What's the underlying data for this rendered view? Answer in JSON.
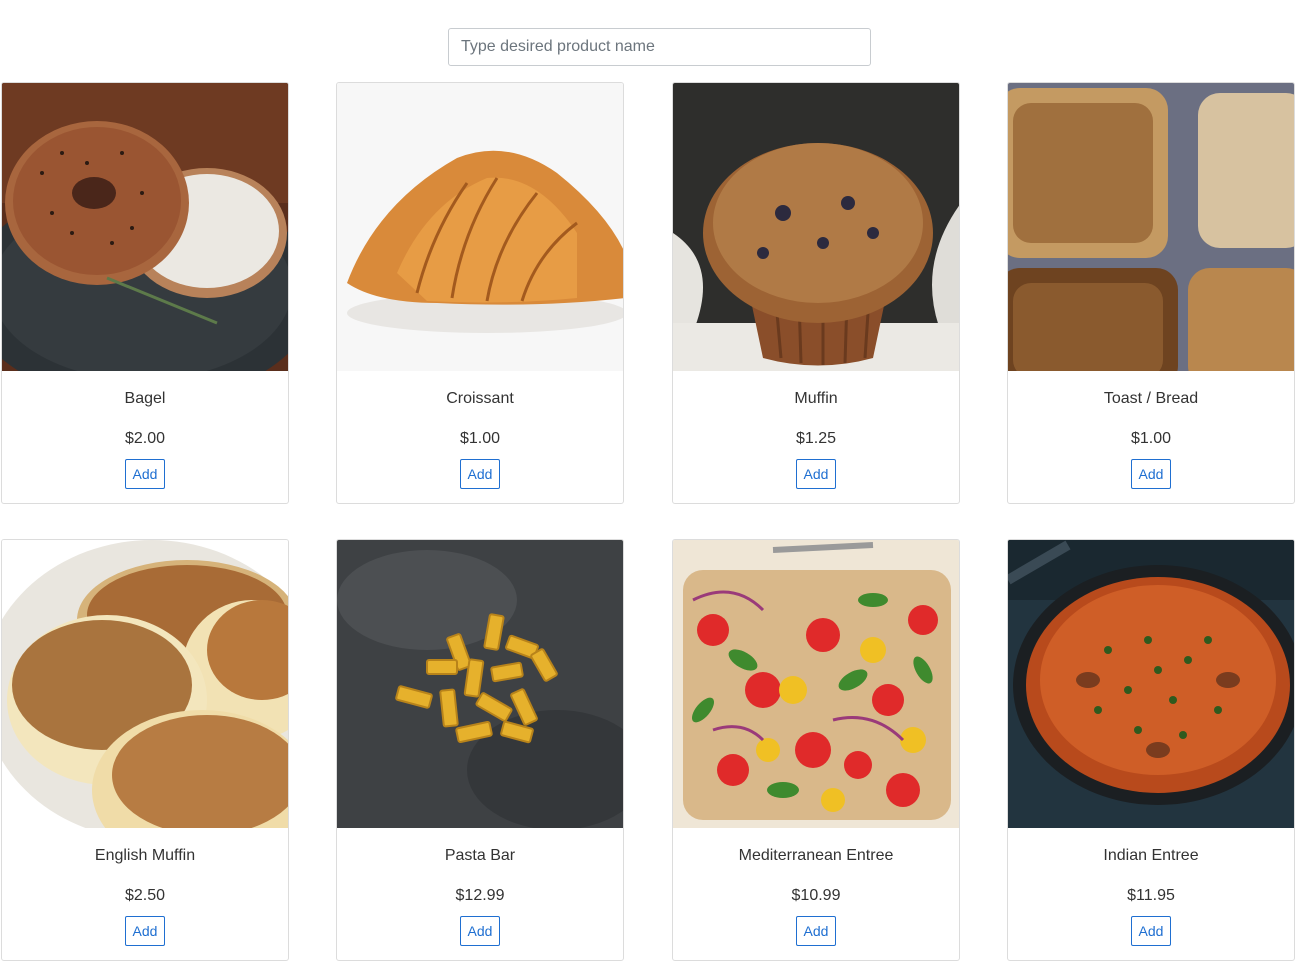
{
  "search": {
    "placeholder": "Type desired product name",
    "value": ""
  },
  "products": [
    {
      "name": "Bagel",
      "price": "$2.00",
      "button": "Add",
      "image": "bagel-photo"
    },
    {
      "name": "Croissant",
      "price": "$1.00",
      "button": "Add",
      "image": "croissant-photo"
    },
    {
      "name": "Muffin",
      "price": "$1.25",
      "button": "Add",
      "image": "muffin-photo"
    },
    {
      "name": "Toast / Bread",
      "price": "$1.00",
      "button": "Add",
      "image": "toast-photo"
    },
    {
      "name": "English Muffin",
      "price": "$2.50",
      "button": "Add",
      "image": "english-muffin-photo"
    },
    {
      "name": "Pasta Bar",
      "price": "$12.99",
      "button": "Add",
      "image": "pasta-photo"
    },
    {
      "name": "Mediterranean Entree",
      "price": "$10.99",
      "button": "Add",
      "image": "salad-photo"
    },
    {
      "name": "Indian Entree",
      "price": "$11.95",
      "button": "Add",
      "image": "curry-photo"
    }
  ]
}
